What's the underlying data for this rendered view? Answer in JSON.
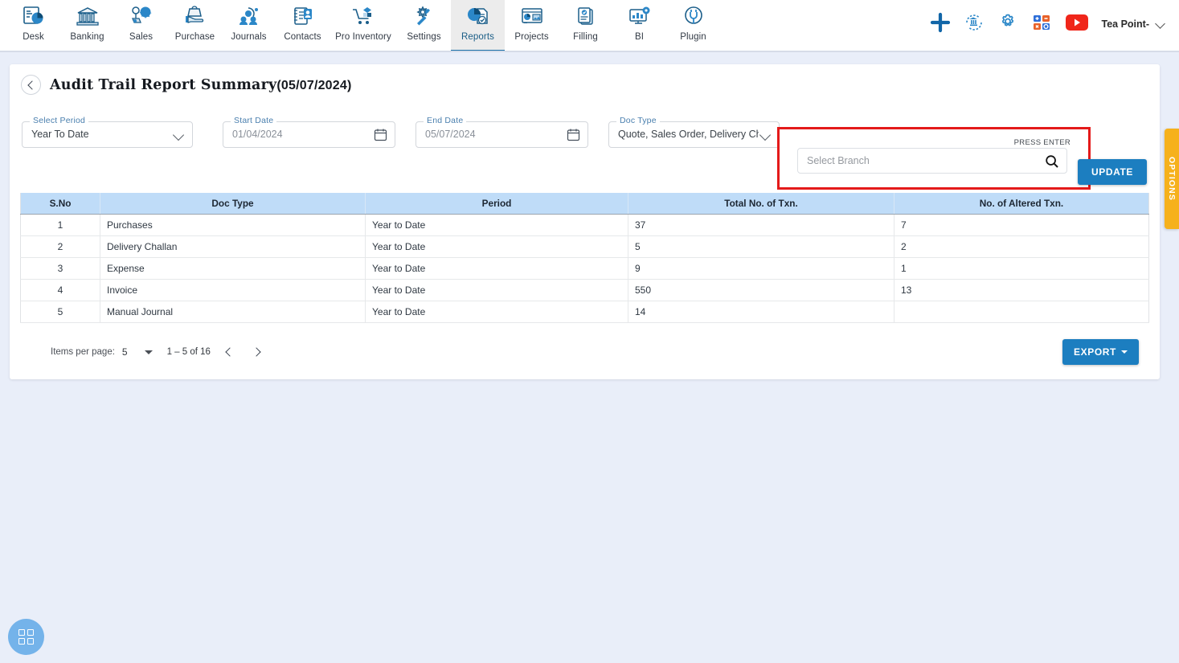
{
  "topnav": {
    "items": [
      {
        "label": "Desk",
        "icon": "desk-icon",
        "active": false
      },
      {
        "label": "Banking",
        "icon": "bank-icon",
        "active": false
      },
      {
        "label": "Sales",
        "icon": "sales-icon",
        "active": false
      },
      {
        "label": "Purchase",
        "icon": "purchase-icon",
        "active": false
      },
      {
        "label": "Journals",
        "icon": "journals-icon",
        "active": false
      },
      {
        "label": "Contacts",
        "icon": "contacts-icon",
        "active": false
      },
      {
        "label": "Pro Inventory",
        "icon": "inventory-icon",
        "active": false
      },
      {
        "label": "Settings",
        "icon": "settings-icon",
        "active": false
      },
      {
        "label": "Reports",
        "icon": "reports-icon",
        "active": true
      },
      {
        "label": "Projects",
        "icon": "projects-icon",
        "active": false
      },
      {
        "label": "Filling",
        "icon": "filling-icon",
        "active": false
      },
      {
        "label": "BI",
        "icon": "bi-icon",
        "active": false
      },
      {
        "label": "Plugin",
        "icon": "plugin-icon",
        "active": false
      }
    ],
    "actions": [
      {
        "name": "add-icon"
      },
      {
        "name": "bank-sync-icon"
      },
      {
        "name": "gear-icon"
      },
      {
        "name": "calculator-icon"
      },
      {
        "name": "youtube-icon"
      }
    ],
    "user": {
      "name": "Tea Point-",
      "chevron": "chevron-down-icon"
    }
  },
  "header": {
    "back_icon": "chevron-left-icon",
    "title": "Audit Trail Report Summary",
    "title_date": "(05/07/2024)"
  },
  "filters": {
    "period": {
      "label": "Select Period",
      "value": "Year To Date"
    },
    "start": {
      "label": "Start Date",
      "value": "01/04/2024"
    },
    "end": {
      "label": "End Date",
      "value": "05/07/2024"
    },
    "doc_type": {
      "label": "Doc Type",
      "value": "Quote, Sales Order, Delivery Cha..."
    },
    "branch": {
      "hint": "PRESS ENTER",
      "placeholder": "Select Branch",
      "value": "",
      "highlight_color": "#e41a1a"
    }
  },
  "buttons": {
    "update": "UPDATE",
    "export": "EXPORT"
  },
  "options_tab": {
    "label": "OPTIONS",
    "color": "#f6b11c"
  },
  "table": {
    "columns": [
      "S.No",
      "Doc Type",
      "Period",
      "Total No. of Txn.",
      "No. of Altered Txn."
    ],
    "rows": [
      {
        "sno": "1",
        "doc_type": "Purchases",
        "period": "Year to Date",
        "total": "37",
        "altered": "7"
      },
      {
        "sno": "2",
        "doc_type": "Delivery Challan",
        "period": "Year to Date",
        "total": "5",
        "altered": "2"
      },
      {
        "sno": "3",
        "doc_type": "Expense",
        "period": "Year to Date",
        "total": "9",
        "altered": "1"
      },
      {
        "sno": "4",
        "doc_type": "Invoice",
        "period": "Year to Date",
        "total": "550",
        "altered": "13"
      },
      {
        "sno": "5",
        "doc_type": "Manual Journal",
        "period": "Year to Date",
        "total": "14",
        "altered": ""
      }
    ],
    "header_bg": "#bfdcf8",
    "link_color": "#2e6da4"
  },
  "paginator": {
    "items_per_page_label": "Items per page:",
    "items_per_page_value": "5",
    "range_label": "1 – 5 of 16",
    "prev_icon": "chevron-left-icon",
    "next_icon": "chevron-right-icon"
  },
  "fab": {
    "icon": "apps-grid-icon"
  }
}
